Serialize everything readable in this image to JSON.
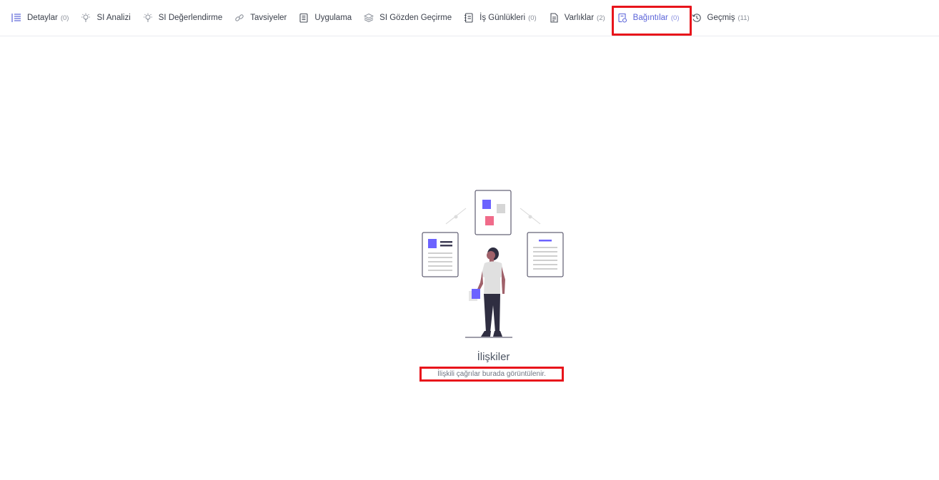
{
  "tabs": [
    {
      "label": "Detaylar",
      "count": "(0)",
      "icon": "list-icon"
    },
    {
      "label": "SI Analizi",
      "count": "",
      "icon": "lightbulb-icon"
    },
    {
      "label": "SI Değerlendirme",
      "count": "",
      "icon": "lightbulb-icon"
    },
    {
      "label": "Tavsiyeler",
      "count": "",
      "icon": "link-icon"
    },
    {
      "label": "Uygulama",
      "count": "",
      "icon": "clipboard-icon"
    },
    {
      "label": "SI Gözden Geçirme",
      "count": "",
      "icon": "layers-icon"
    },
    {
      "label": "İş Günlükleri",
      "count": "(0)",
      "icon": "notebook-icon"
    },
    {
      "label": "Varlıklar",
      "count": "(2)",
      "icon": "asset-icon"
    },
    {
      "label": "Bağıntılar",
      "count": "(0)",
      "icon": "relation-icon",
      "active": true
    },
    {
      "label": "Geçmiş",
      "count": "(11)",
      "icon": "history-icon"
    }
  ],
  "empty_state": {
    "title": "İlişkiler",
    "subtitle": "İlişkili çağrılar burada görüntülenir."
  },
  "colors": {
    "accent": "#5b64d9",
    "highlight_box": "#e8141b",
    "illustration_purple": "#6c63ff",
    "illustration_pink": "#f06b8a",
    "illustration_gray": "#d6d6d6"
  }
}
